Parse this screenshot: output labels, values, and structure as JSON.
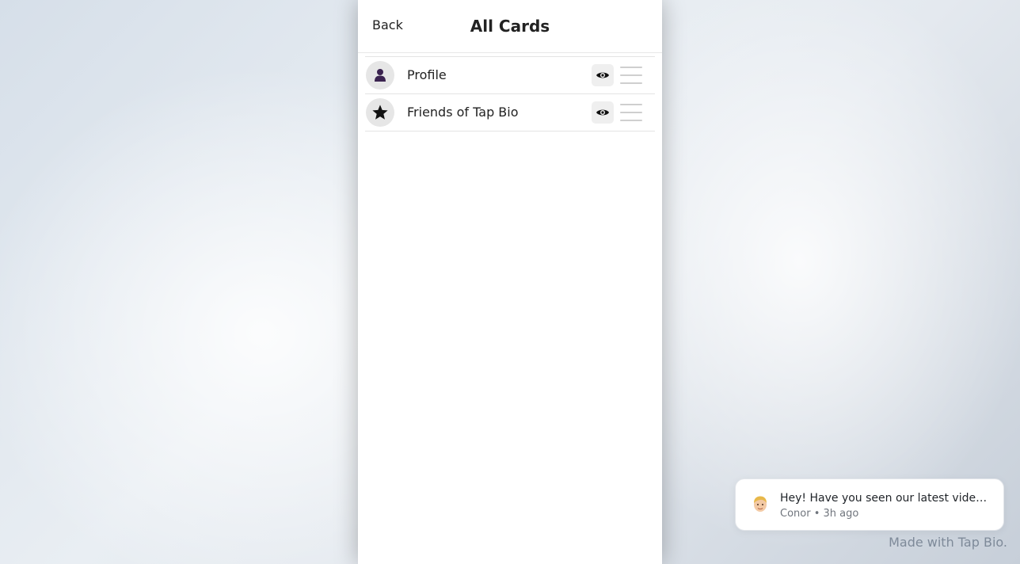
{
  "header": {
    "back_label": "Back",
    "title": "All Cards"
  },
  "cards": [
    {
      "label": "Profile",
      "icon": "person-icon",
      "visible": true
    },
    {
      "label": "Friends of Tap Bio",
      "icon": "star-icon",
      "visible": true
    }
  ],
  "notification": {
    "message": "Hey! Have you seen our latest video tutorial? It's really cool!",
    "sender": "Conor",
    "time": "3h ago",
    "separator": "•"
  },
  "footer": {
    "made_with": "Made with Tap Bio."
  },
  "colors": {
    "profile_icon": "#3b2350",
    "star_icon": "#111111"
  }
}
